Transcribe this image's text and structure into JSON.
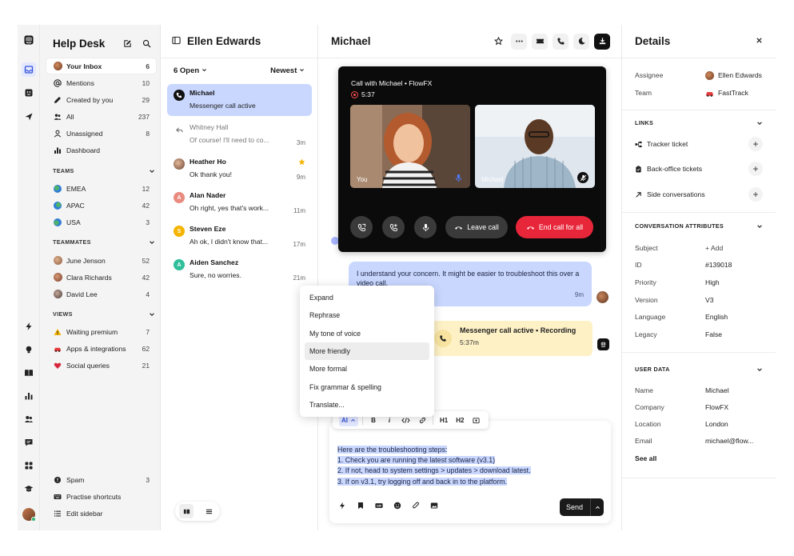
{
  "inbox": {
    "title": "Help Desk",
    "items": [
      {
        "label": "Your Inbox",
        "count": "6"
      },
      {
        "label": "Mentions",
        "count": "10"
      },
      {
        "label": "Created by you",
        "count": "29"
      },
      {
        "label": "All",
        "count": "237"
      },
      {
        "label": "Unassigned",
        "count": "8"
      },
      {
        "label": "Dashboard",
        "count": ""
      }
    ],
    "teams_header": "TEAMS",
    "teams": [
      {
        "label": "EMEA",
        "count": "12"
      },
      {
        "label": "APAC",
        "count": "42"
      },
      {
        "label": "USA",
        "count": "3"
      }
    ],
    "teammates_header": "TEAMMATES",
    "teammates": [
      {
        "label": "June Jenson",
        "count": "52"
      },
      {
        "label": "Clara Richards",
        "count": "42"
      },
      {
        "label": "David Lee",
        "count": "4"
      }
    ],
    "views_header": "VIEWS",
    "views": [
      {
        "label": "Waiting premium",
        "count": "7"
      },
      {
        "label": "Apps & integrations",
        "count": "62"
      },
      {
        "label": "Social queries",
        "count": "21"
      }
    ],
    "footer": [
      {
        "label": "Spam",
        "count": "3"
      },
      {
        "label": "Practise shortcuts",
        "count": ""
      },
      {
        "label": "Edit sidebar",
        "count": ""
      }
    ]
  },
  "conv_list": {
    "title": "Ellen Edwards",
    "filter": "6 Open",
    "sort": "Newest",
    "items": [
      {
        "name": "Michael",
        "preview": "Messenger call active",
        "time": ""
      },
      {
        "name": "Whitney Hall",
        "preview": "Of course! I'll need to co...",
        "time": "3m"
      },
      {
        "name": "Heather Ho",
        "preview": "Ok thank you!",
        "time": "9m"
      },
      {
        "name": "Alan Nader",
        "preview": "Oh right, yes that's work...",
        "time": "11m"
      },
      {
        "name": "Steven Eze",
        "preview": "Ah ok, I didn't know that...",
        "time": "17m"
      },
      {
        "name": "Aiden Sanchez",
        "preview": "Sure, no worries.",
        "time": "21m"
      }
    ],
    "avatar_letters": {
      "alan": "A",
      "steven": "S",
      "aiden": "A"
    }
  },
  "conversation": {
    "title": "Michael",
    "call": {
      "title": "Call with Michael • FlowFX",
      "timer": "5:37",
      "tile_left_name": "You",
      "tile_right_name": "Michael",
      "leave_label": "Leave call",
      "end_label": "End call for all"
    },
    "message": {
      "text": "I understand your concern. It might be easier to troubleshoot this over a video call.",
      "time": "9m"
    },
    "note": {
      "title": "Messenger call active • Recording",
      "duration": "5:37m"
    },
    "ai_menu": [
      "Expand",
      "Rephrase",
      "My tone of voice",
      "More friendly",
      "More formal",
      "Fix grammar & spelling",
      "Translate..."
    ],
    "format_toolbar": {
      "ai": "AI",
      "bold": "B",
      "italic": "i",
      "h1": "H1",
      "h2": "H2"
    },
    "draft_lines": [
      "Here are the troubleshooting steps:",
      "1. Check you are running the latest software (v3.1)",
      "2. If not, head to system settings > updates > download latest.",
      "3. If on v3.1, try logging off and back in to the platform."
    ],
    "send_label": "Send"
  },
  "details": {
    "title": "Details",
    "assignee_label": "Assignee",
    "assignee": "Ellen Edwards",
    "team_label": "Team",
    "team": "FastTrack",
    "links_header": "LINKS",
    "links": [
      "Tracker ticket",
      "Back-office tickets",
      "Side conversations"
    ],
    "attrs_header": "CONVERSATION ATTRIBUTES",
    "attrs": [
      {
        "k": "Subject",
        "v": "+ Add"
      },
      {
        "k": "ID",
        "v": "#139018"
      },
      {
        "k": "Priority",
        "v": "High"
      },
      {
        "k": "Version",
        "v": "V3"
      },
      {
        "k": "Language",
        "v": "English"
      },
      {
        "k": "Legacy",
        "v": "False"
      }
    ],
    "user_header": "USER DATA",
    "user": [
      {
        "k": "Name",
        "v": "Michael"
      },
      {
        "k": "Company",
        "v": "FlowFX"
      },
      {
        "k": "Location",
        "v": "London"
      },
      {
        "k": "Email",
        "v": "michael@flow..."
      }
    ],
    "see_all": "See all"
  },
  "colors": {
    "accent": "#c9d7ff",
    "end_call": "#e8263a",
    "note": "#fdf1c5"
  }
}
